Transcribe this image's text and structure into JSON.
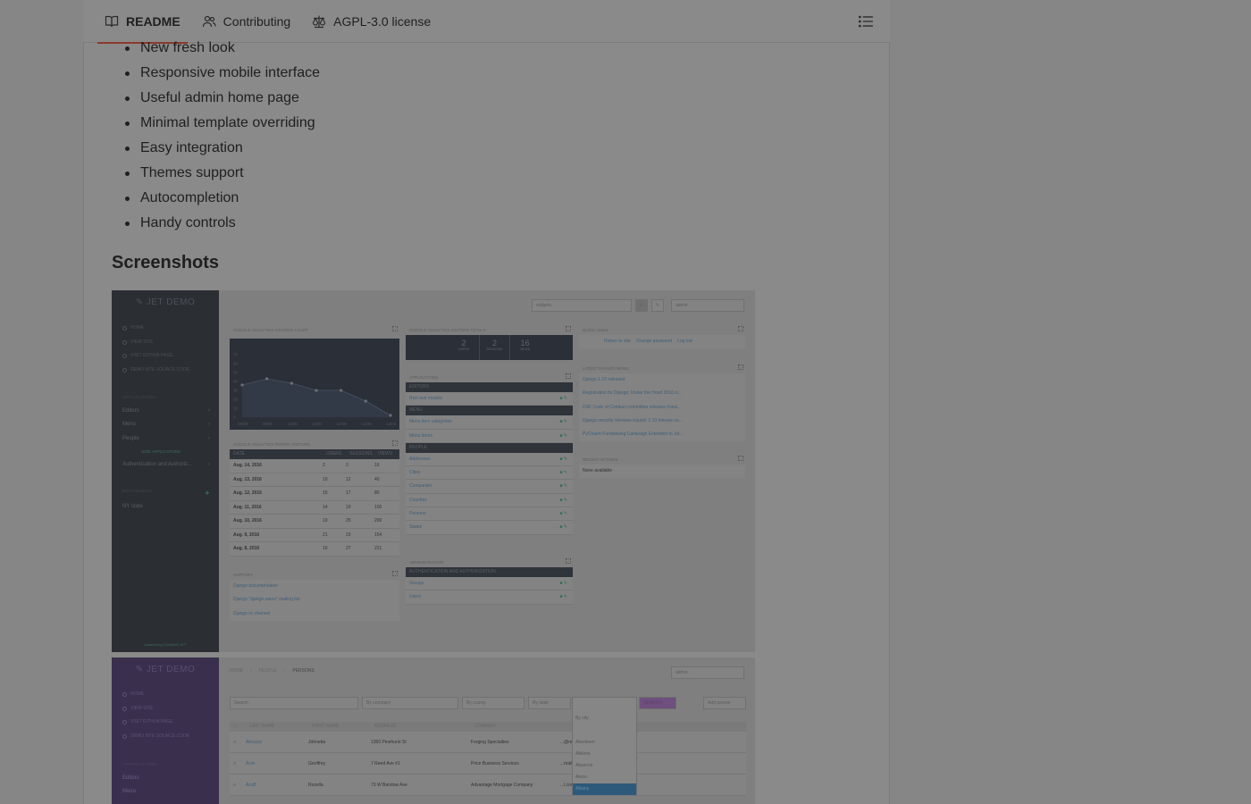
{
  "tabs": [
    {
      "label": "README",
      "icon": "book-icon",
      "active": true
    },
    {
      "label": "Contributing",
      "icon": "people-icon",
      "active": false
    },
    {
      "label": "AGPL-3.0 license",
      "icon": "law-icon",
      "active": false
    }
  ],
  "toc_icon": "list-icon",
  "features": [
    "New fresh look",
    "Responsive mobile interface",
    "Useful admin home page",
    "Minimal template overriding",
    "Easy integration",
    "Themes support",
    "Autocompletion",
    "Handy controls"
  ],
  "section_title": "Screenshots",
  "shot1": {
    "logo": "✎ JET DEMO",
    "nav": [
      "HOME",
      "VIEW SITE",
      "VISIT GITHUB PAGE",
      "DEMO SITE SOURCE CODE"
    ],
    "apps_head": "APPLICATIONS",
    "apps": [
      "Editors",
      "Menu",
      "People"
    ],
    "hide_apps": "HIDE APPLICATIONS",
    "auth": "Authentication and Authoriz...",
    "bookmarks_head": "BOOKMARKS",
    "bookmarks": [
      "NY state"
    ],
    "footer": "powered by DJANGO JET",
    "widgets_select": "widgets",
    "user_select": "admin",
    "chart_title": "GOOGLE ANALYTICS VISITORS CHART",
    "chart_data": {
      "type": "line",
      "x": [
        "08/08",
        "09/08",
        "10/08",
        "11/08",
        "12/08",
        "13/08",
        "14/08"
      ],
      "values": [
        36,
        43,
        38,
        30,
        30,
        18,
        2
      ],
      "ylim": [
        0,
        80
      ],
      "yticks": [
        "0",
        "10",
        "20",
        "30",
        "40",
        "50",
        "60",
        "70"
      ]
    },
    "totals_title": "GOOGLE ANALYTICS VISITORS TOTALS",
    "totals": [
      {
        "value": "2",
        "label": "USERS"
      },
      {
        "value": "2",
        "label": "SESSIONS"
      },
      {
        "value": "16",
        "label": "VIEWS"
      }
    ],
    "quick_title": "QUICK LINKS",
    "quick_links": [
      "Return to site",
      "Change password",
      "Log out"
    ],
    "period_title": "GOOGLE ANALYTICS PERIOD VISITORS",
    "period_headers": [
      "DATE",
      "USERS",
      "SESSIONS",
      "VIEWS"
    ],
    "period_rows": [
      [
        "Aug. 14, 2016",
        "2",
        "2",
        "16"
      ],
      [
        "Aug. 13, 2016",
        "10",
        "12",
        "40"
      ],
      [
        "Aug. 12, 2016",
        "15",
        "17",
        "80"
      ],
      [
        "Aug. 11, 2016",
        "14",
        "19",
        "100"
      ],
      [
        "Aug. 10, 2016",
        "19",
        "25",
        "200"
      ],
      [
        "Aug. 9, 2016",
        "21",
        "23",
        "154"
      ],
      [
        "Aug. 8, 2016",
        "16",
        "27",
        "221"
      ]
    ],
    "apps_title": "APPLICATIONS",
    "editors_head": "EDITORS",
    "editors": [
      "Rich text models"
    ],
    "menu_head": "MENU",
    "menu": [
      "Menu item categories",
      "Menu items"
    ],
    "people_head": "PEOPLE",
    "people": [
      "Addresses",
      "Cities",
      "Companies",
      "Counties",
      "Persons",
      "States"
    ],
    "news_title": "LATEST DJANGO NEWS",
    "news": [
      "Django 1.10 released",
      "Registration for Django: Under the Hood 2016 is...",
      "DSF Code of Conduct committee releases trans...",
      "Django security releases issued: 1.10 release ca...",
      "PyCharm Fundraising Campaign Extended to Jul..."
    ],
    "recent_title": "RECENT ACTIONS",
    "recent_empty": "None available",
    "support_title": "SUPPORT",
    "support": [
      "Django documentation",
      "Django \"django-users\" mailing list",
      "Django irc channel"
    ],
    "admin_title": "ADMINISTRATION",
    "auth_head": "AUTHENTICATION AND AUTHORIZATION",
    "auth_items": [
      "Groups",
      "Users"
    ]
  },
  "shot2": {
    "logo": "✎ JET DEMO",
    "nav": [
      "HOME",
      "VIEW SITE",
      "VISIT GITHUB PAGE",
      "DEMO SITE SOURCE CODE"
    ],
    "apps_head": "APPLICATIONS",
    "apps": [
      "Editors",
      "Menu"
    ],
    "breadcrumb": [
      "HOME",
      "PEOPLE",
      "PERSONS"
    ],
    "user_select": "admin",
    "search_placeholder": "Search",
    "filters": [
      "By company",
      "By county",
      "By state"
    ],
    "city_filter": "By city",
    "city_options": [
      "Aberdeen",
      "Abilene",
      "Absecon",
      "Akron",
      "Albany"
    ],
    "search_button": "SEARCH",
    "add_button": "Add person",
    "columns": [
      "LAST NAME",
      "FIRST NAME",
      "ADDRESS",
      "COMPANY"
    ],
    "rows": [
      [
        "Abruzzo",
        "Johnetta",
        "1360 Pinehurst St",
        "Forging Specialties",
        "...@mail.com"
      ],
      [
        "Acre",
        "Geoffrey",
        "7 Reed Ave #1",
        "Price Business Services",
        "...mail.com"
      ],
      [
        "Acuff",
        "Rozella",
        "73 W Barstow Ave",
        "Advantage Mortgage Company",
        "...l.com"
      ]
    ]
  }
}
